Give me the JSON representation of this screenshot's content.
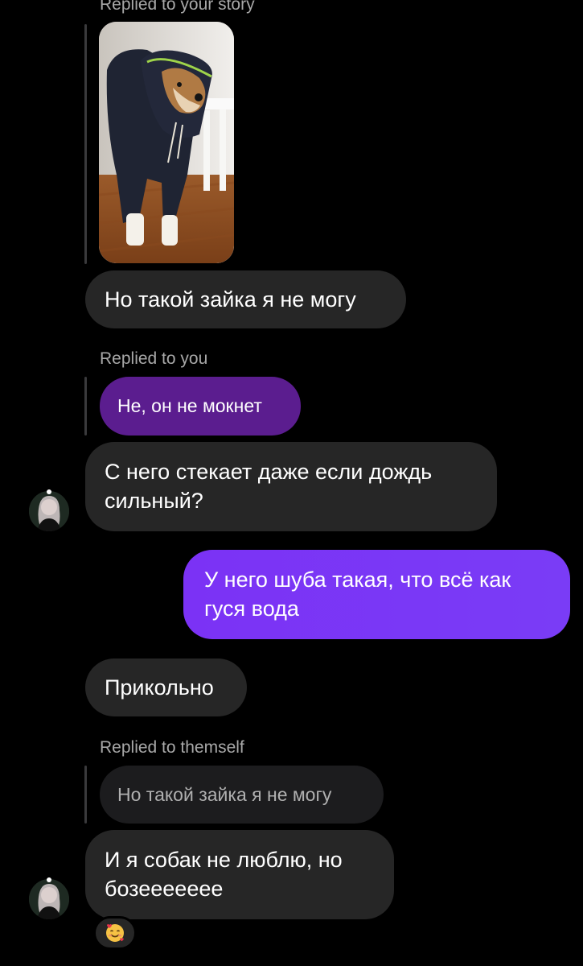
{
  "thread": {
    "story_reply_meta": "Replied to your story",
    "msg1": "Но такой зайка я не могу",
    "reply_you_meta": "Replied to you",
    "quote1": "Не, он не мокнет",
    "msg2": "С него стекает даже если дождь сильный?",
    "msg3_out": "У него шуба такая, что всё как гуся вода",
    "msg4": "Прикольно",
    "reply_themself_meta": "Replied to themself",
    "quote2": "Но такой зайка я не могу",
    "msg5": "И я собак не люблю, но бозеееееее",
    "reaction_icon": "smiling-face-with-hearts-icon"
  },
  "colors": {
    "background": "#000000",
    "incoming_bubble": "#262626",
    "outgoing_bubble": "#7b32f5",
    "quoted_purple": "#5b1d8f",
    "quoted_grey": "#1c1c1e",
    "meta_text": "#a8a8a8"
  }
}
